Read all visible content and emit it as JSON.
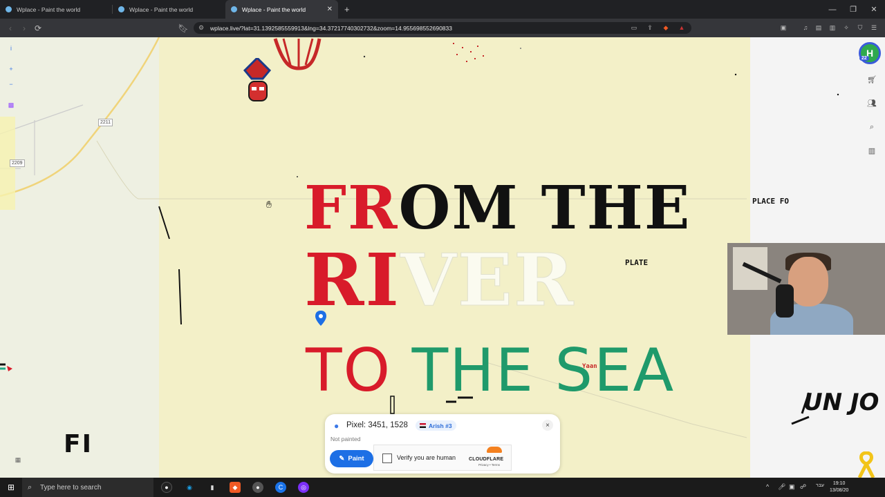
{
  "browser": {
    "tabs": [
      {
        "title": "Wplace - Paint the world",
        "active": false
      },
      {
        "title": "Wplace - Paint the world",
        "active": false
      },
      {
        "title": "Wplace - Paint the world",
        "active": true
      }
    ],
    "new_tab_label": "+",
    "url": "wplace.live/?lat=31.1392585559913&lng=34.37217740302732&zoom=14.955698552690833"
  },
  "map": {
    "road_labels": [
      "2211",
      "2209"
    ],
    "left_tools": [
      "i",
      "+",
      "−"
    ],
    "avatar_level": "22",
    "art_text": {
      "line1_red": "FR",
      "line1_black": "OM THE",
      "line2_red": "RI",
      "line2_ghost": "VER",
      "line3_red": "TO",
      "line3_green": "THE SE",
      "line3_tail": "A",
      "small_place": "PLATE",
      "top_right_text": "PLACE FO",
      "tag_bottom": "Yaan",
      "bottom_left": "FI",
      "bottom_right": "UN JO"
    }
  },
  "panel": {
    "pixel_text": "Pixel: 3451, 1528",
    "region_badge": "Arish #3",
    "status": "Not painted",
    "paint_button": "Paint",
    "verify_label": "Verify you are human",
    "cloudflare_label": "CLOUDFLARE",
    "cloudflare_links": "Privacy • Terms",
    "close_label": "×"
  },
  "taskbar": {
    "search_placeholder": "Type here to search",
    "language": "עבר",
    "time": "19:10",
    "date": "13/08/20"
  },
  "colors": {
    "map_background": "#f3f0c8",
    "accent_blue": "#1d6fe5",
    "art_red": "#d81b2a",
    "art_green": "#1f9a6b"
  }
}
